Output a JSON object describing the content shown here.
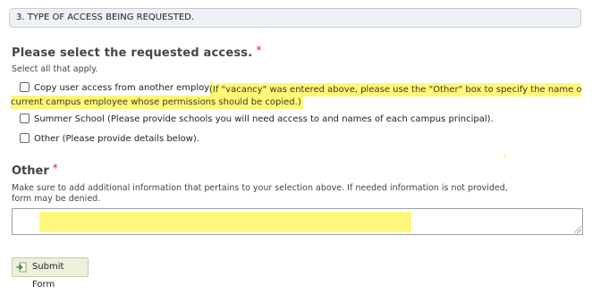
{
  "section": {
    "header": "3. TYPE OF ACCESS BEING REQUESTED."
  },
  "access": {
    "title": "Please select the requested access.",
    "required_marker": "*",
    "hint": "Select all that apply.",
    "options": [
      {
        "label": "Copy user access from another employee.",
        "checked": false
      },
      {
        "label": "Summer School (Please provide schools you will need access to and names of each campus principal).",
        "checked": false
      },
      {
        "label": "Other (Please provide details below).",
        "checked": false
      }
    ],
    "highlight_note_line1": "(If \"vacancy\" was entered above, please use the \"Other\" box to specify the name of a",
    "highlight_note_line2": "current campus employee whose permissions should be copied.)"
  },
  "other": {
    "title": "Other",
    "required_marker": "*",
    "description": "Make sure to add additional information that pertains to your selection above.  If needed information is not provided, form may be denied.",
    "value": ""
  },
  "form": {
    "submit_label": "Submit Form"
  },
  "colors": {
    "highlight": "#fff77a",
    "required": "#d9262f",
    "header_bg": "#eef1f6"
  }
}
